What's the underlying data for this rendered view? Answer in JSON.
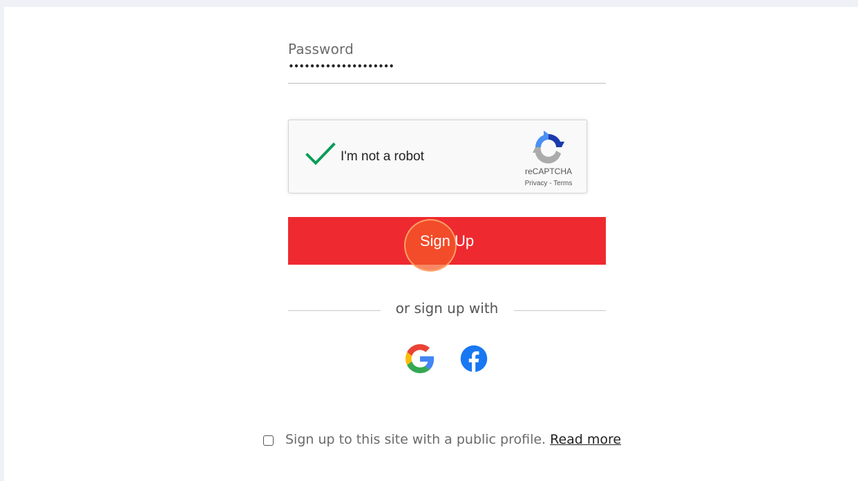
{
  "password": {
    "label": "Password",
    "value": "••••••••••••••••••••"
  },
  "captcha": {
    "label": "I'm not a robot",
    "brand": "reCAPTCHA",
    "privacy": "Privacy",
    "separator": " - ",
    "terms": "Terms",
    "checked": true
  },
  "signup": {
    "button_label": "Sign Up"
  },
  "divider": {
    "text": "or sign up with"
  },
  "social": {
    "google_icon": "google-icon",
    "facebook_icon": "facebook-icon"
  },
  "profile": {
    "text": "Sign up to this site with a public profile.",
    "link": "Read more"
  },
  "colors": {
    "accent": "#ee2a30",
    "check": "#0b9d58",
    "facebook": "#1877f2"
  }
}
